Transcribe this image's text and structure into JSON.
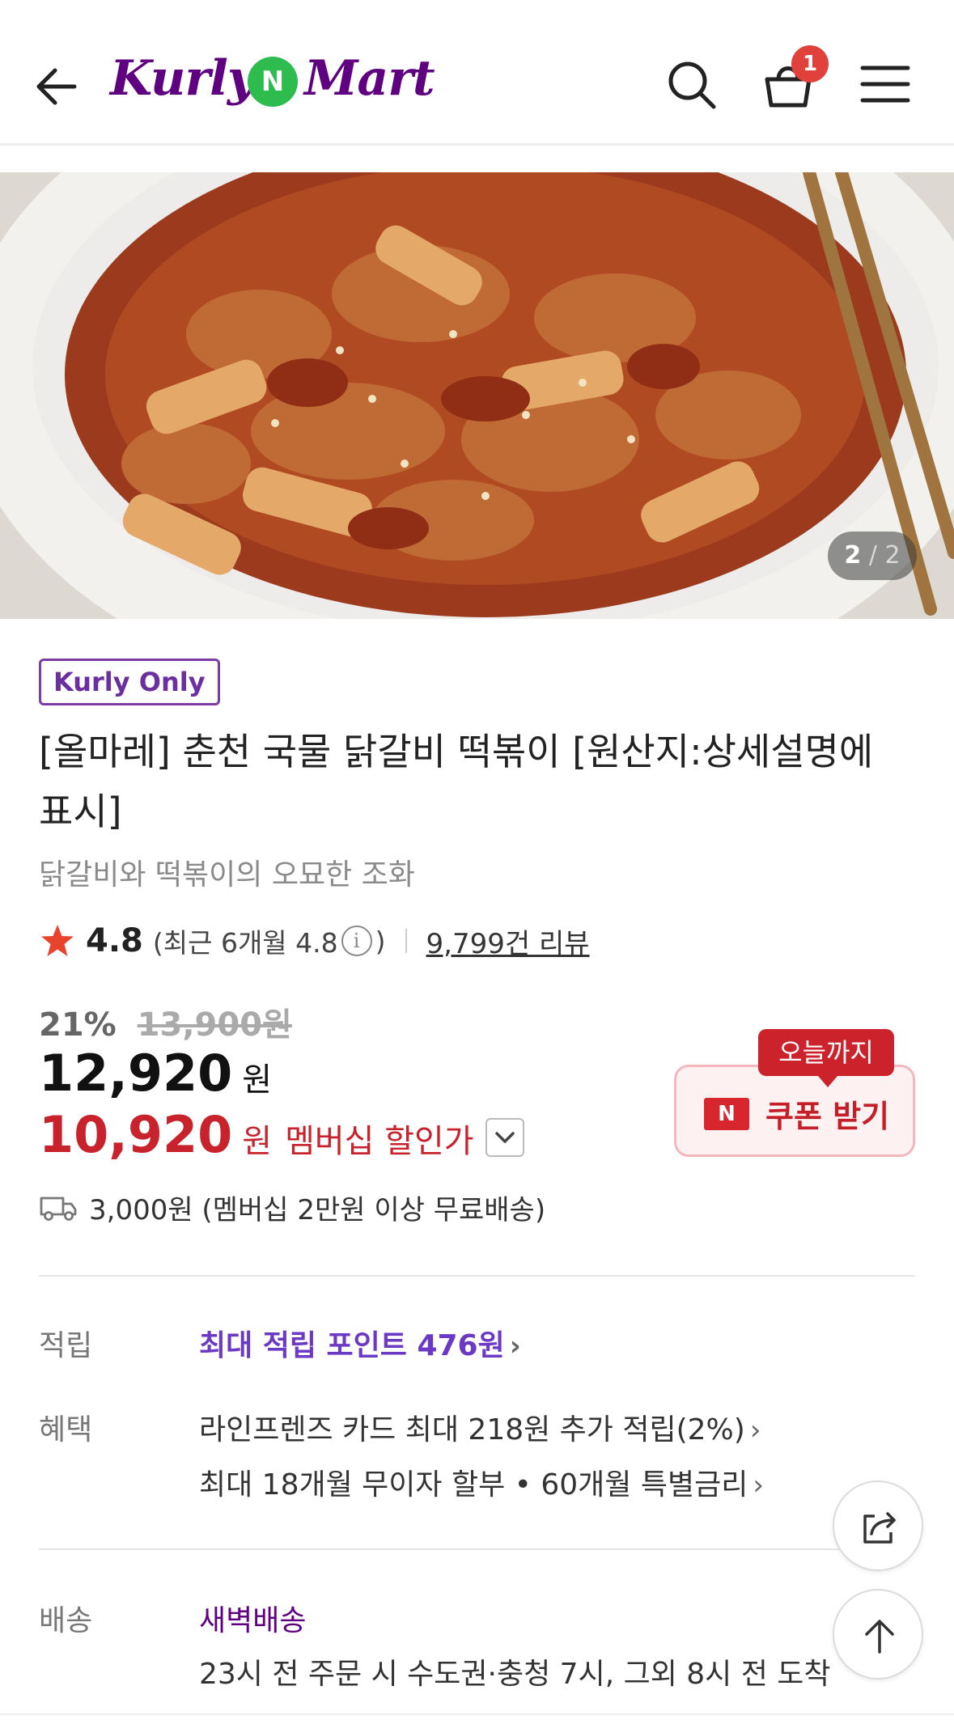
{
  "header": {
    "logo_left": "Kurly",
    "logo_n": "N",
    "logo_right": "Mart",
    "cart_count": "1"
  },
  "gallery": {
    "current": "2",
    "separator": "/",
    "total": "2"
  },
  "product": {
    "badge": "Kurly Only",
    "title": "[올마레] 춘천 국물 닭갈비 떡볶이 [원산지:상세설명에 표시]",
    "subtitle": "닭갈비와 떡볶이의 오묘한 조화",
    "rating": "4.8",
    "rating_recent_prefix": "(최근 6개월 4.8",
    "rating_recent_suffix": ")",
    "info_icon": "i",
    "review_count": "9,799건 리뷰"
  },
  "price": {
    "discount_rate": "21%",
    "original_price": "13,900원",
    "sale_price": "12,920",
    "currency": "원",
    "member_price": "10,920",
    "member_currency": "원",
    "member_label": "멤버십 할인가"
  },
  "coupon": {
    "tag": "오늘까지",
    "n_icon": "N",
    "label": "쿠폰 받기"
  },
  "shipping_fee": "3,000원 (멤버십 2만원 이상 무료배송)",
  "details": {
    "points_label": "적립",
    "points_value": "최대 적립 포인트 476원",
    "benefit_label": "혜택",
    "benefit_1": "라인프렌즈 카드 최대 218원 추가 적립(2%)",
    "benefit_2": "최대 18개월 무이자 할부 • 60개월 특별금리",
    "delivery_label": "배송",
    "delivery_type": "새벽배송",
    "delivery_desc": "23시 전 주문 시 수도권·충청 7시, 그외 8시 전 도착"
  },
  "colors": {
    "brand_purple": "#5f0080",
    "logo_green": "#2ebc4f",
    "discount_red": "#c8222c",
    "badge_red": "#e0413b"
  }
}
